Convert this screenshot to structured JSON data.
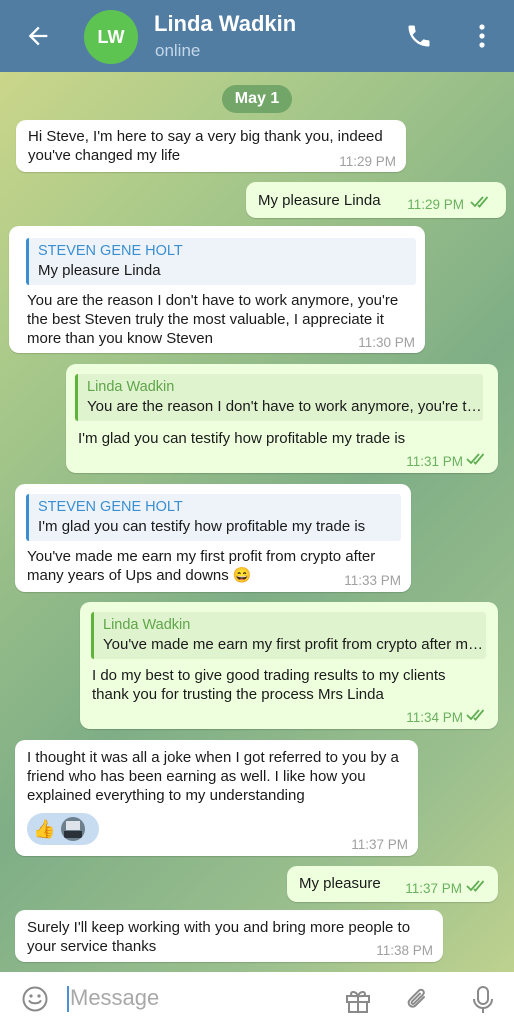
{
  "header": {
    "avatar_initials": "LW",
    "contact_name": "Linda Wadkin",
    "status": "online"
  },
  "date_chip": "May 1",
  "messages": [
    {
      "direction": "in",
      "text": "Hi Steve, I'm here to say a very big thank you, indeed you've changed my life",
      "time": "11:29 PM"
    },
    {
      "direction": "out",
      "text": "My pleasure Linda",
      "time": "11:29 PM",
      "status": "read"
    },
    {
      "direction": "in",
      "reply_name": "STEVEN GENE HOLT",
      "reply_text": "My pleasure Linda",
      "text": "You are the reason I don't have to work anymore, you're the best Steven truly the most valuable, I appreciate it more than you know Steven",
      "time": "11:30 PM"
    },
    {
      "direction": "out",
      "reply_name": "Linda Wadkin",
      "reply_text": "You are the reason I don't have to work anymore, you're the best Steven truly the most valuable",
      "text": "I'm glad you can testify how profitable my trade is",
      "time": "11:31 PM",
      "status": "read"
    },
    {
      "direction": "in",
      "reply_name": "STEVEN GENE HOLT",
      "reply_text": "I'm glad you can testify how profitable my trade is",
      "text": "You've made me earn my first profit from crypto after many years of Ups and downs 😄",
      "time": "11:33 PM"
    },
    {
      "direction": "out",
      "reply_name": "Linda Wadkin",
      "reply_text": "You've made me earn my first profit from crypto after many years of Ups and downs",
      "text": "I do my best to give good trading results to my clients thank you for trusting the process Mrs Linda",
      "time": "11:34 PM",
      "status": "read"
    },
    {
      "direction": "in",
      "text": "I thought it was all a joke when I got referred to you by a friend who has been earning as well. I like how you explained everything to my understanding",
      "reaction": "👍",
      "time": "11:37 PM"
    },
    {
      "direction": "out",
      "text": "My pleasure",
      "time": "11:37 PM",
      "status": "read"
    },
    {
      "direction": "in",
      "text": "Surely I'll keep working with you and bring more people to your service thanks",
      "time": "11:38 PM"
    }
  ],
  "composer": {
    "placeholder": "Message"
  },
  "icons": {
    "back": "arrow-left-icon",
    "call": "phone-icon",
    "more": "more-vertical-icon",
    "emoji": "emoji-icon",
    "gift": "gift-icon",
    "attach": "paperclip-icon",
    "mic": "microphone-icon"
  },
  "colors": {
    "header": "#517da2",
    "outgoing_bubble": "#eeffde",
    "incoming_bubble": "#ffffff",
    "avatar": "#5dc452",
    "accent": "#3a8fd0"
  }
}
